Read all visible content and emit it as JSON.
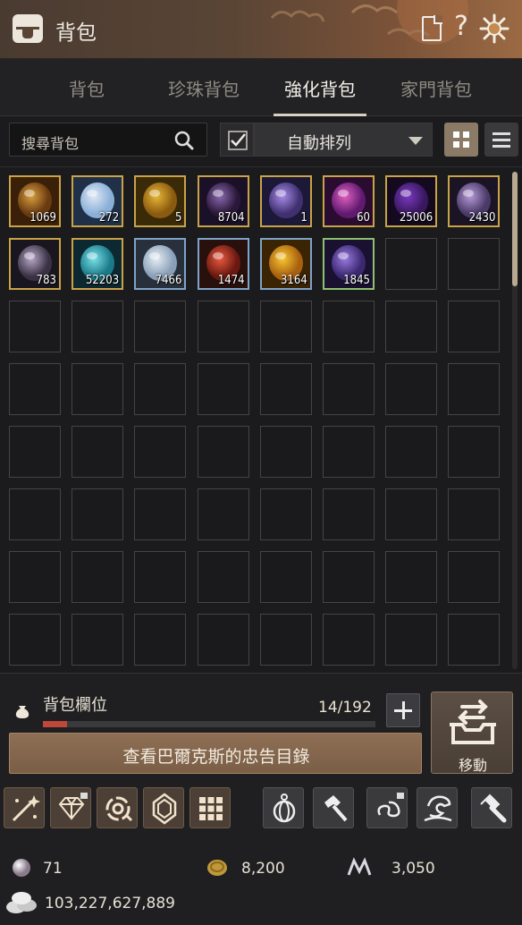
{
  "window": {
    "title": "背包"
  },
  "tabs": [
    {
      "label": "背包",
      "active": false
    },
    {
      "label": "珍珠背包",
      "active": false
    },
    {
      "label": "強化背包",
      "active": true
    },
    {
      "label": "家門背包",
      "active": false
    }
  ],
  "search": {
    "label": "搜尋背包"
  },
  "sort": {
    "checked": true,
    "label": "自動排列"
  },
  "items": [
    {
      "icon": "gold-orb-item",
      "count": "1069",
      "border": "#c9a348"
    },
    {
      "icon": "white-crystal-orb-item",
      "count": "272",
      "border": "#c9a348"
    },
    {
      "icon": "golden-egg-item",
      "count": "5",
      "border": "#c9a348"
    },
    {
      "icon": "dark-crystal-item",
      "count": "8704",
      "border": "#c9a348"
    },
    {
      "icon": "purple-gem-item",
      "count": "1",
      "border": "#c9a348"
    },
    {
      "icon": "purple-vortex-item",
      "count": "60",
      "border": "#c9a348"
    },
    {
      "icon": "black-purple-orb-item",
      "count": "25006",
      "border": "#c9a348"
    },
    {
      "icon": "purple-stone-item",
      "count": "2430",
      "border": "#c9a348"
    },
    {
      "icon": "grey-stone-item",
      "count": "783",
      "border": "#c9a348"
    },
    {
      "icon": "cyan-orb-item",
      "count": "52203",
      "border": "#c9a348"
    },
    {
      "icon": "white-shell-item",
      "count": "7466",
      "border": "#7fa3c9"
    },
    {
      "icon": "red-stone-item",
      "count": "1474",
      "border": "#7fa3c9"
    },
    {
      "icon": "golden-flame-item",
      "count": "3164",
      "border": "#7fa3c9"
    },
    {
      "icon": "violet-stone-item",
      "count": "1845",
      "border": "#8fc070"
    }
  ],
  "capacity": {
    "label": "背包欄位",
    "text": "14/192",
    "fraction": 0.073
  },
  "buttons": {
    "advice": "查看巴爾克斯的忠告目錄",
    "move": "移動"
  },
  "toolbar": [
    "magic-wand-icon",
    "diamond-icon",
    "refresh-gear-icon",
    "crystal-icon",
    "grid-icon",
    "lantern-icon",
    "hammer-icon",
    "swirl-icon",
    "dragon-icon",
    "anvil-hammer-icon"
  ],
  "currency": {
    "pearl": "71",
    "coin": "8,200",
    "mileage": "3,050",
    "silver": "103,227,627,889"
  },
  "colors": {
    "accent": "#8a7a66",
    "header": "#5a4535",
    "capacity_bar": "#c0473a"
  }
}
